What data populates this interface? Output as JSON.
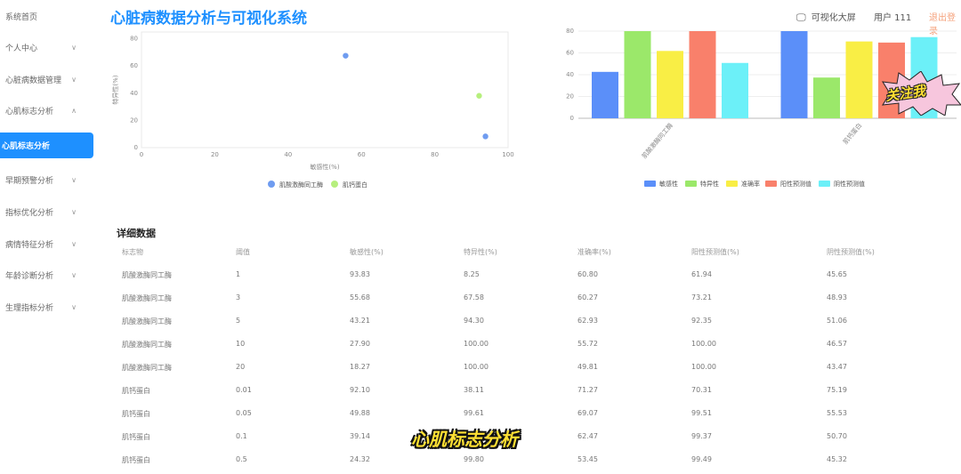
{
  "sidebar": {
    "items": [
      {
        "label": "系统首页",
        "chevron": false
      },
      {
        "label": "个人中心",
        "chevron": true
      },
      {
        "label": "心脏病数据管理",
        "chevron": true
      },
      {
        "label": "心肌标志分析",
        "chevron": "up"
      },
      {
        "label": "心肌标志分析",
        "active": true
      },
      {
        "label": "早期预警分析",
        "chevron": true
      },
      {
        "label": "指标优化分析",
        "chevron": true
      },
      {
        "label": "病情特征分析",
        "chevron": true
      },
      {
        "label": "年龄诊断分析",
        "chevron": true
      },
      {
        "label": "生理指标分析",
        "chevron": true
      }
    ],
    "chevron_down_glyph": "∨",
    "chevron_up_glyph": "∧"
  },
  "header": {
    "title": "心脏病数据分析与可视化系统",
    "big_screen": "可视化大屏",
    "big_screen_icon": "monitor-icon",
    "user": "用户 111",
    "logout": "退出登录"
  },
  "scatter_chart": {
    "x_ticks": [
      "0",
      "20",
      "40",
      "60",
      "80",
      "100"
    ],
    "y_ticks": [
      "0",
      "20",
      "40",
      "60",
      "80"
    ],
    "xlabel": "敏感性(%)",
    "ylabel": "特异性(%)",
    "legend": [
      "肌酸激酶同工酶",
      "肌钙蛋白"
    ],
    "colors": [
      "#6f9cf0",
      "#b6ef7d"
    ],
    "points": [
      {
        "series": 0,
        "x": 55.68,
        "y": 67.58
      },
      {
        "series": 1,
        "x": 92.1,
        "y": 38.11
      },
      {
        "series": 0,
        "x": 93.83,
        "y": 8.25
      }
    ],
    "xlim": [
      0,
      100
    ],
    "ylim": [
      0,
      85
    ]
  },
  "bar_chart": {
    "categories": [
      "肌酸激酶同工酶",
      "肌钙蛋白"
    ],
    "y_ticks": [
      "0",
      "20",
      "40",
      "60",
      "80"
    ],
    "ylim": [
      0,
      80
    ],
    "series": [
      {
        "name": "敏感性",
        "color": "#5b8ff9",
        "values": [
          42.6,
          80.0
        ]
      },
      {
        "name": "特异性",
        "color": "#9be86a",
        "values": [
          80.0,
          37.4
        ]
      },
      {
        "name": "准确率",
        "color": "#f9ee45",
        "values": [
          61.8,
          70.5
        ]
      },
      {
        "name": "阳性预测值",
        "color": "#f9806b",
        "values": [
          80.0,
          69.5
        ]
      },
      {
        "name": "阴性预测值",
        "color": "#6cf0f8",
        "values": [
          50.8,
          74.5
        ]
      }
    ]
  },
  "table": {
    "title": "详细数据",
    "headers": [
      "标志物",
      "阈值",
      "敏感性(%)",
      "特异性(%)",
      "准确率(%)",
      "阳性预测值(%)",
      "阴性预测值(%)"
    ],
    "rows": [
      [
        "肌酸激酶同工酶",
        "1",
        "93.83",
        "8.25",
        "60.80",
        "61.94",
        "45.65"
      ],
      [
        "肌酸激酶同工酶",
        "3",
        "55.68",
        "67.58",
        "60.27",
        "73.21",
        "48.93"
      ],
      [
        "肌酸激酶同工酶",
        "5",
        "43.21",
        "94.30",
        "62.93",
        "92.35",
        "51.06"
      ],
      [
        "肌酸激酶同工酶",
        "10",
        "27.90",
        "100.00",
        "55.72",
        "100.00",
        "46.57"
      ],
      [
        "肌酸激酶同工酶",
        "20",
        "18.27",
        "100.00",
        "49.81",
        "100.00",
        "43.47"
      ],
      [
        "肌钙蛋白",
        "0.01",
        "92.10",
        "38.11",
        "71.27",
        "70.31",
        "75.19"
      ],
      [
        "肌钙蛋白",
        "0.05",
        "49.88",
        "99.61",
        "69.07",
        "99.51",
        "55.53"
      ],
      [
        "肌钙蛋白",
        "0.1",
        "39.14",
        "",
        "62.47",
        "99.37",
        "50.70"
      ],
      [
        "肌钙蛋白",
        "0.5",
        "24.32",
        "99.80",
        "53.45",
        "99.49",
        "45.32"
      ]
    ]
  },
  "overlay": {
    "caption": "心肌标志分析",
    "sticker": "关注我"
  }
}
